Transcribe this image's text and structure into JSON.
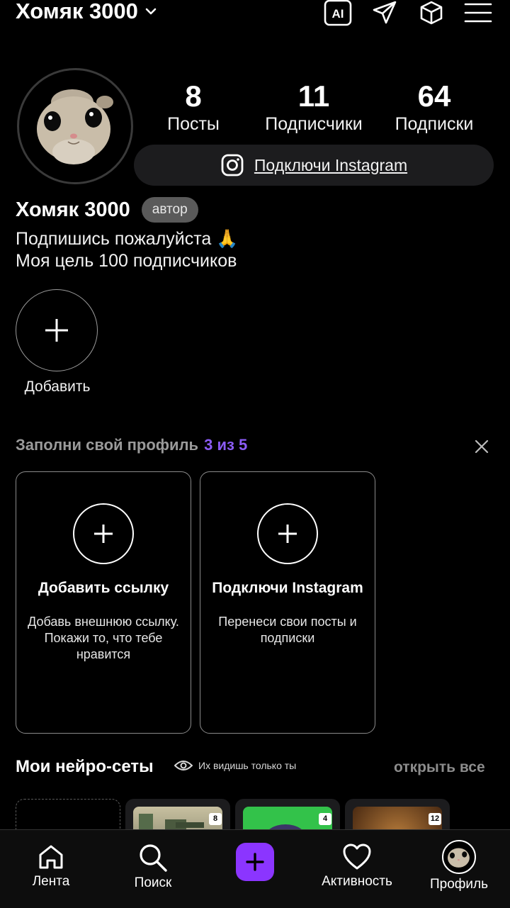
{
  "header": {
    "username": "Хомяк 3000",
    "ai_label": "AI"
  },
  "profile": {
    "stats": [
      {
        "value": "8",
        "label": "Посты"
      },
      {
        "value": "11",
        "label": "Подписчики"
      },
      {
        "value": "64",
        "label": "Подписки"
      }
    ],
    "instagram_button": "Подключи Instagram",
    "name": "Хомяк 3000",
    "badge": "автор",
    "bio_line1": "Подпишись пожалуйста 🙏",
    "bio_line2": "Моя цель 100 подписчиков",
    "add_story_label": "Добавить"
  },
  "complete_profile": {
    "title": "Заполни свой профиль",
    "progress": "3 из 5",
    "cards": [
      {
        "title": "Добавить ссылку",
        "description": "Добавь внешнюю ссылку. Покажи то, что тебе нравится"
      },
      {
        "title": "Подключи Instagram",
        "description": "Перенеси свои посты и подписки"
      }
    ]
  },
  "neuro_nets": {
    "title": "Мои нейро-сеты",
    "visibility": "Их видишь только ты",
    "open_all": "открыть все",
    "items": [
      {
        "count": "8"
      },
      {
        "count": "4"
      },
      {
        "count": "12"
      }
    ]
  },
  "bottom_nav": {
    "feed": "Лента",
    "search": "Поиск",
    "activity": "Активность",
    "profile": "Профиль"
  },
  "colors": {
    "accent": "#8b5cf6",
    "nav_plus": "#8b35ff",
    "background": "#000000"
  }
}
